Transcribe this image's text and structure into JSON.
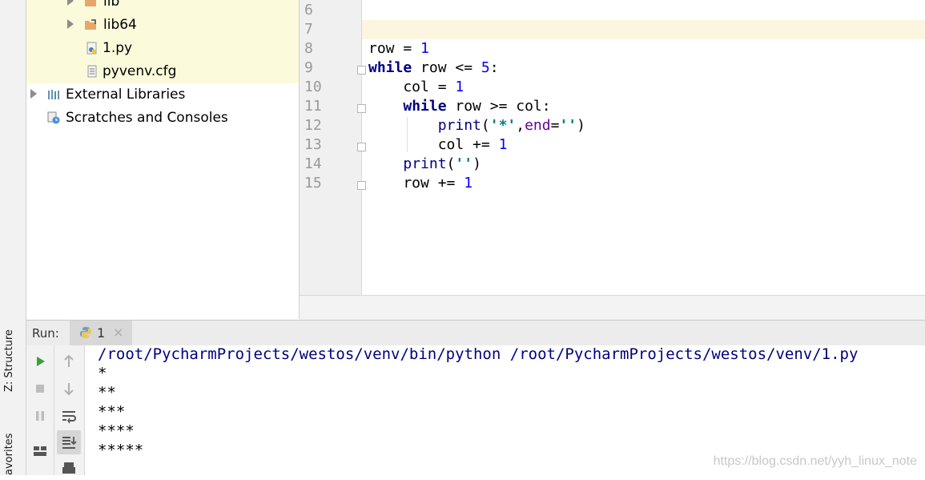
{
  "tool_strip": {
    "structure_label": "Z: Structure",
    "favorites_label": "avorites"
  },
  "project_tree": {
    "items": [
      {
        "label": "lib"
      },
      {
        "label": "lib64"
      },
      {
        "label": "1.py"
      },
      {
        "label": "pyvenv.cfg"
      },
      {
        "label": "External Libraries"
      },
      {
        "label": "Scratches and Consoles"
      }
    ]
  },
  "editor": {
    "line_numbers": [
      "6",
      "7",
      "8",
      "9",
      "10",
      "11",
      "12",
      "13",
      "14",
      "15"
    ],
    "code": {
      "l8": {
        "a": "row = ",
        "b": "1"
      },
      "l9": {
        "kw": "while",
        "a": " row <= ",
        "num": "5",
        "b": ":"
      },
      "l10": {
        "a": "    col = ",
        "num": "1"
      },
      "l11": {
        "pad": "    ",
        "kw": "while",
        "a": " row >= col:"
      },
      "l12": {
        "pad": "        ",
        "fn": "print",
        "a": "(",
        "s": "'*'",
        "b": ",",
        "kwa": "end",
        "c": "=",
        "s2": "''",
        "d": ")"
      },
      "l13": {
        "a": "        col += ",
        "num": "1"
      },
      "l14": {
        "pad": "    ",
        "fn": "print",
        "a": "(",
        "s": "''",
        "b": ")"
      },
      "l15": {
        "a": "    row += ",
        "num": "1"
      }
    }
  },
  "run": {
    "label": "Run:",
    "tab_label": "1",
    "tab_close": "×",
    "console_lines": [
      "/root/PycharmProjects/westos/venv/bin/python /root/PycharmProjects/westos/venv/1.py",
      "*",
      "**",
      "***",
      "****",
      "*****"
    ]
  },
  "watermark": "https://blog.csdn.net/yyh_linux_note",
  "colors": {
    "accent_green": "#3d9e3d",
    "highlight": "#fbfbdc",
    "current_line": "#fcf6e1"
  }
}
